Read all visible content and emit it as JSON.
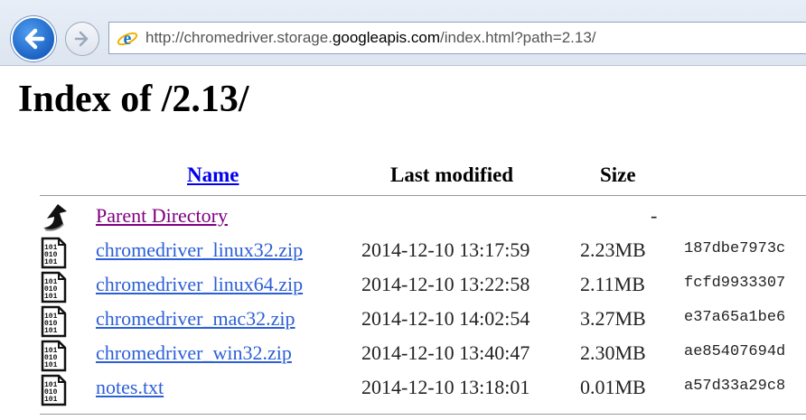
{
  "browser": {
    "address": {
      "prefix": "http://chromedriver.storage.",
      "domain": "googleapis.com",
      "suffix": "/index.html?path=2.13/"
    }
  },
  "page": {
    "title": "Index of /2.13/",
    "columns": {
      "name": "Name",
      "last_modified": "Last modified",
      "size": "Size"
    },
    "rows": [
      {
        "icon": "back-arrow-icon",
        "name": "Parent Directory",
        "modified": "",
        "size": "-",
        "hash": ""
      },
      {
        "icon": "binary-file-icon",
        "name": "chromedriver_linux32.zip",
        "modified": "2014-12-10 13:17:59",
        "size": "2.23MB",
        "hash": "187dbe7973c"
      },
      {
        "icon": "binary-file-icon",
        "name": "chromedriver_linux64.zip",
        "modified": "2014-12-10 13:22:58",
        "size": "2.11MB",
        "hash": "fcfd9933307"
      },
      {
        "icon": "binary-file-icon",
        "name": "chromedriver_mac32.zip",
        "modified": "2014-12-10 14:02:54",
        "size": "3.27MB",
        "hash": "e37a65a1be6"
      },
      {
        "icon": "binary-file-icon",
        "name": "chromedriver_win32.zip",
        "modified": "2014-12-10 13:40:47",
        "size": "2.30MB",
        "hash": "ae85407694d"
      },
      {
        "icon": "binary-file-icon",
        "name": "notes.txt",
        "modified": "2014-12-10 13:18:01",
        "size": "0.01MB",
        "hash": "a57d33a29c8"
      }
    ]
  },
  "colors": {
    "link": "#2c5fd6",
    "visited_link": "#800080",
    "header_link": "#0000ee"
  }
}
